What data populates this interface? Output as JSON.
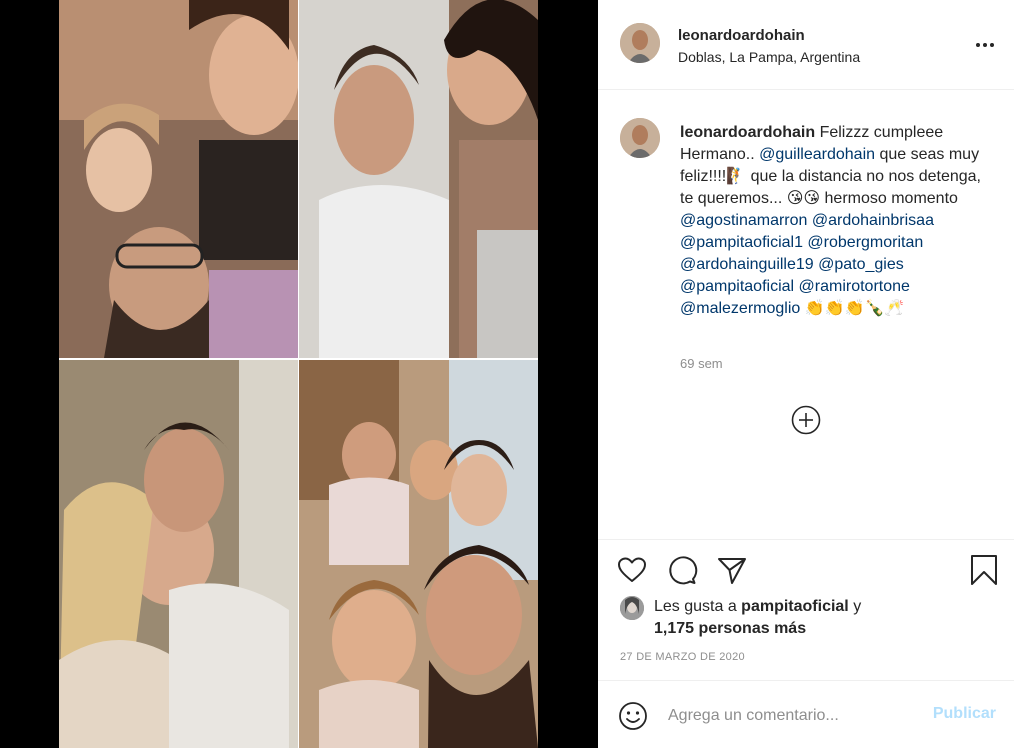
{
  "post": {
    "username": "leonardoardohain",
    "location": "Doblas, La Pampa, Argentina"
  },
  "caption": {
    "username": "leonardoardohain",
    "parts": [
      {
        "text": "Felizzz cumpleee Hermano.. ",
        "mention": false
      },
      {
        "text": "@guilleardohain",
        "mention": true
      },
      {
        "text": " que seas muy feliz!!!!🧗 que la distancia no nos detenga, te queremos... 😘😘 hermoso momento ",
        "mention": false
      },
      {
        "text": "@agostinamarron",
        "mention": true
      },
      {
        "text": " ",
        "mention": false
      },
      {
        "text": "@ardohainbrisaa",
        "mention": true
      },
      {
        "text": " ",
        "mention": false
      },
      {
        "text": "@pampitaoficial1",
        "mention": true
      },
      {
        "text": " ",
        "mention": false
      },
      {
        "text": "@robergmoritan",
        "mention": true
      },
      {
        "text": " ",
        "mention": false
      },
      {
        "text": "@ardohainguille19",
        "mention": true
      },
      {
        "text": " ",
        "mention": false
      },
      {
        "text": "@pato_gies",
        "mention": true
      },
      {
        "text": " ",
        "mention": false
      },
      {
        "text": "@pampitaoficial",
        "mention": true
      },
      {
        "text": " ",
        "mention": false
      },
      {
        "text": "@ramirotortone",
        "mention": true
      },
      {
        "text": " ",
        "mention": false
      },
      {
        "text": "@malezermoglio",
        "mention": true
      },
      {
        "text": " 👏👏👏🍾🥂",
        "mention": false
      }
    ],
    "time_ago": "69 sem"
  },
  "likes": {
    "prefix": "Les gusta a ",
    "first_liker": "pampitaoficial",
    "suffix": " y",
    "others": "1,175 personas más"
  },
  "date": "27 DE MARZO DE 2020",
  "comment_box": {
    "placeholder": "Agrega un comentario...",
    "publish_label": "Publicar"
  },
  "icons": {
    "more": "more-horizontal-icon",
    "load_more": "plus-circle-icon",
    "like": "heart-icon",
    "comment": "comment-bubble-icon",
    "share": "paper-plane-icon",
    "save": "bookmark-icon",
    "emoji": "smiley-icon"
  },
  "colors": {
    "mention": "#00376b",
    "muted": "#8e8e8e",
    "publish_disabled": "#b2dffc",
    "text": "#262626",
    "divider": "#efefef"
  }
}
